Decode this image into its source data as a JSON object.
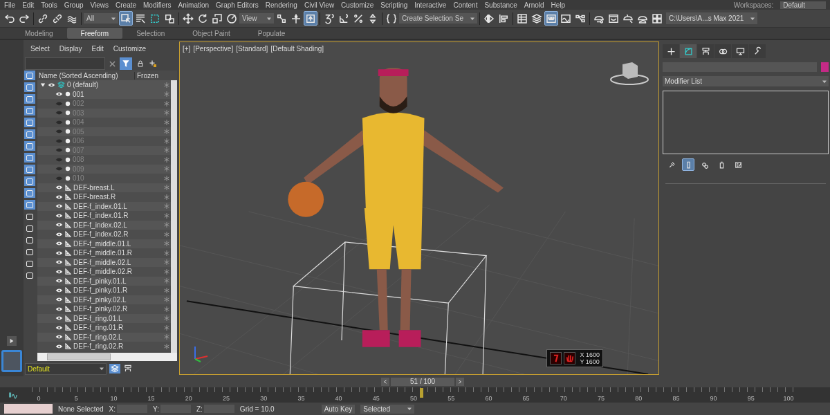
{
  "menu_bar": {
    "items": [
      "File",
      "Edit",
      "Tools",
      "Group",
      "Views",
      "Create",
      "Modifiers",
      "Animation",
      "Graph Editors",
      "Rendering",
      "Civil View",
      "Customize",
      "Scripting",
      "Interactive",
      "Content",
      "Substance",
      "Arnold",
      "Help"
    ],
    "workspaces_label": "Workspaces:",
    "workspace": "Default"
  },
  "toolbar": {
    "items": [
      {
        "kind": "undo",
        "active": false
      },
      {
        "kind": "redo",
        "active": false
      },
      {
        "kind": "separator"
      },
      {
        "kind": "link",
        "active": false
      },
      {
        "kind": "unlink",
        "active": false
      },
      {
        "kind": "bind",
        "active": false
      },
      {
        "kind": "separator"
      },
      {
        "kind": "dropdown",
        "label": "All"
      },
      {
        "kind": "select",
        "active": true
      },
      {
        "kind": "select-by-name",
        "active": false
      },
      {
        "kind": "region",
        "active": false
      },
      {
        "kind": "window-crossing",
        "active": false
      },
      {
        "kind": "separator"
      },
      {
        "kind": "move",
        "active": false
      },
      {
        "kind": "rotate",
        "active": false
      },
      {
        "kind": "scale",
        "active": false
      },
      {
        "kind": "placement",
        "active": false
      },
      {
        "kind": "dropdown",
        "label": "View"
      },
      {
        "kind": "pivot",
        "active": false
      },
      {
        "kind": "manipulate",
        "active": false
      },
      {
        "kind": "key-mode",
        "active": true
      },
      {
        "kind": "separator"
      },
      {
        "kind": "snap",
        "active": false
      },
      {
        "kind": "angle-snap",
        "active": false
      },
      {
        "kind": "percent-snap",
        "active": false
      },
      {
        "kind": "spinner-snap",
        "active": false
      },
      {
        "kind": "separator"
      },
      {
        "kind": "named-sets",
        "active": false
      },
      {
        "kind": "dropdown",
        "label": "Create Selection Se"
      },
      {
        "kind": "separator"
      },
      {
        "kind": "mirror",
        "active": false
      },
      {
        "kind": "align",
        "active": false
      },
      {
        "kind": "separator"
      },
      {
        "kind": "table",
        "active": false
      },
      {
        "kind": "layers",
        "active": false
      },
      {
        "kind": "ribbon",
        "active": true
      },
      {
        "kind": "curve-editor",
        "active": false
      },
      {
        "kind": "schematic",
        "active": false
      },
      {
        "kind": "separator"
      },
      {
        "kind": "render-setup",
        "active": false
      },
      {
        "kind": "render-frame",
        "active": false
      },
      {
        "kind": "render",
        "active": false
      },
      {
        "kind": "render-cloud",
        "active": false
      },
      {
        "kind": "viewports",
        "active": false
      },
      {
        "kind": "path",
        "label": "C:\\Users\\A...s Max 2021"
      }
    ]
  },
  "ribbon": {
    "tabs": [
      {
        "label": "Modeling",
        "selected": false
      },
      {
        "label": "Freeform",
        "selected": true
      },
      {
        "label": "Selection",
        "selected": false
      },
      {
        "label": "Object Paint",
        "selected": false
      },
      {
        "label": "Populate",
        "selected": false
      }
    ]
  },
  "scene_explorer": {
    "menu": [
      "Select",
      "Display",
      "Edit",
      "Customize"
    ],
    "filters": [
      {
        "on": true
      },
      {
        "on": true
      },
      {
        "on": true
      },
      {
        "on": true
      },
      {
        "on": true
      },
      {
        "on": true
      },
      {
        "on": true
      },
      {
        "on": true
      },
      {
        "on": true
      },
      {
        "on": true
      },
      {
        "on": true
      },
      {
        "on": true
      },
      {
        "on": false
      },
      {
        "on": false
      },
      {
        "on": false
      },
      {
        "on": false
      },
      {
        "on": false
      },
      {
        "on": false
      }
    ],
    "columns": [
      "Name (Sorted Ascending)",
      "Frozen"
    ],
    "layers": [
      {
        "name": "0 (default)",
        "expanded": true,
        "visible": true,
        "children": [
          {
            "name": "001",
            "kind": "point",
            "visible": true
          },
          {
            "name": "002",
            "kind": "point",
            "visible": false
          },
          {
            "name": "003",
            "kind": "point",
            "visible": false
          },
          {
            "name": "004",
            "kind": "point",
            "visible": false
          },
          {
            "name": "005",
            "kind": "point",
            "visible": false
          },
          {
            "name": "006",
            "kind": "point",
            "visible": false
          },
          {
            "name": "007",
            "kind": "point",
            "visible": false
          },
          {
            "name": "008",
            "kind": "point",
            "visible": false
          },
          {
            "name": "009",
            "kind": "point",
            "visible": false
          },
          {
            "name": "010",
            "kind": "point",
            "visible": false
          },
          {
            "name": "DEF-breast.L",
            "kind": "bone",
            "visible": true
          },
          {
            "name": "DEF-breast.R",
            "kind": "bone",
            "visible": true
          },
          {
            "name": "DEF-f_index.01.L",
            "kind": "bone",
            "visible": true
          },
          {
            "name": "DEF-f_index.01.R",
            "kind": "bone",
            "visible": true
          },
          {
            "name": "DEF-f_index.02.L",
            "kind": "bone",
            "visible": true
          },
          {
            "name": "DEF-f_index.02.R",
            "kind": "bone",
            "visible": true
          },
          {
            "name": "DEF-f_middle.01.L",
            "kind": "bone",
            "visible": true
          },
          {
            "name": "DEF-f_middle.01.R",
            "kind": "bone",
            "visible": true
          },
          {
            "name": "DEF-f_middle.02.L",
            "kind": "bone",
            "visible": true
          },
          {
            "name": "DEF-f_middle.02.R",
            "kind": "bone",
            "visible": true
          },
          {
            "name": "DEF-f_pinky.01.L",
            "kind": "bone",
            "visible": true
          },
          {
            "name": "DEF-f_pinky.01.R",
            "kind": "bone",
            "visible": true
          },
          {
            "name": "DEF-f_pinky.02.L",
            "kind": "bone",
            "visible": true
          },
          {
            "name": "DEF-f_pinky.02.R",
            "kind": "bone",
            "visible": true
          },
          {
            "name": "DEF-f_ring.01.L",
            "kind": "bone",
            "visible": true
          },
          {
            "name": "DEF-f_ring.01.R",
            "kind": "bone",
            "visible": true
          },
          {
            "name": "DEF-f_ring.02.L",
            "kind": "bone",
            "visible": true
          },
          {
            "name": "DEF-f_ring.02.R",
            "kind": "bone",
            "visible": true
          }
        ]
      }
    ],
    "layer_dropdown": "Default"
  },
  "viewport": {
    "labels": [
      "[+]",
      "[Perspective]",
      "[Standard]",
      "[Default Shading]"
    ],
    "overlay": {
      "x": "X 1600",
      "y": "Y 1600"
    }
  },
  "command_panel": {
    "tabs": [
      {
        "kind": "create",
        "selected": false
      },
      {
        "kind": "modify",
        "selected": true
      },
      {
        "kind": "hierarchy",
        "selected": false
      },
      {
        "kind": "motion",
        "selected": false
      },
      {
        "kind": "display",
        "selected": false
      },
      {
        "kind": "utilities",
        "selected": false
      }
    ],
    "modifier_list": "Modifier List",
    "stack_buttons": [
      {
        "kind": "pin",
        "active": false
      },
      {
        "kind": "show-end",
        "active": true
      },
      {
        "kind": "make-unique",
        "active": false
      },
      {
        "kind": "remove",
        "active": false
      },
      {
        "kind": "configure",
        "active": false
      }
    ]
  },
  "time_slider": {
    "label": "51 / 100",
    "level": 0.51
  },
  "ruler": {
    "ticks": [
      "0",
      "5",
      "10",
      "15",
      "20",
      "25",
      "30",
      "35",
      "40",
      "45",
      "50",
      "55",
      "60",
      "65",
      "70",
      "75",
      "80",
      "85",
      "90",
      "95",
      "100"
    ]
  },
  "status_bar": {
    "selection": "None Selected",
    "coords": [
      "X:",
      "Y:",
      "Z:"
    ],
    "grid": "Grid = 10.0",
    "auto_key": "Auto Key",
    "key_filter": "Selected"
  }
}
